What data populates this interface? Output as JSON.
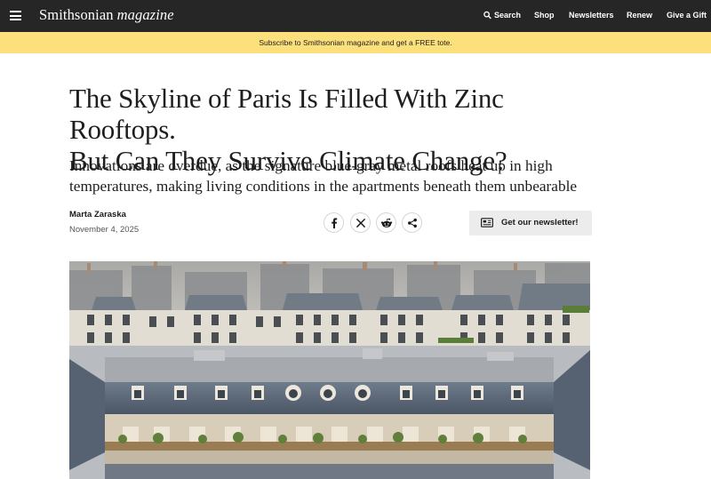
{
  "header": {
    "logo_brand": "Smithsonian",
    "logo_sub": "magazine",
    "nav": {
      "search": "Search",
      "shop": "Shop",
      "newsletters": "Newsletters",
      "renew": "Renew",
      "gift": "Give a Gift"
    }
  },
  "promo": {
    "text": "Subscribe to Smithsonian magazine and get a FREE tote."
  },
  "article": {
    "title_line1": "The Skyline of Paris Is Filled With Zinc Rooftops.",
    "title_line2": "But Can They Survive Climate Change?",
    "dek": "Innovations are overdue, as the signature blue-gray metal roofs heat up in high temperatures, making living conditions in the apartments beneath them unbearable",
    "author": "Marta Zaraska",
    "date": "November 4, 2025"
  },
  "share": {
    "icons": [
      "facebook-icon",
      "x-icon",
      "reddit-icon",
      "share-icon"
    ]
  },
  "newsletter": {
    "label": "Get our newsletter!"
  },
  "colors": {
    "topbar": "#262626",
    "promo": "#fbe07c",
    "newsletter_bg": "#ececec"
  }
}
